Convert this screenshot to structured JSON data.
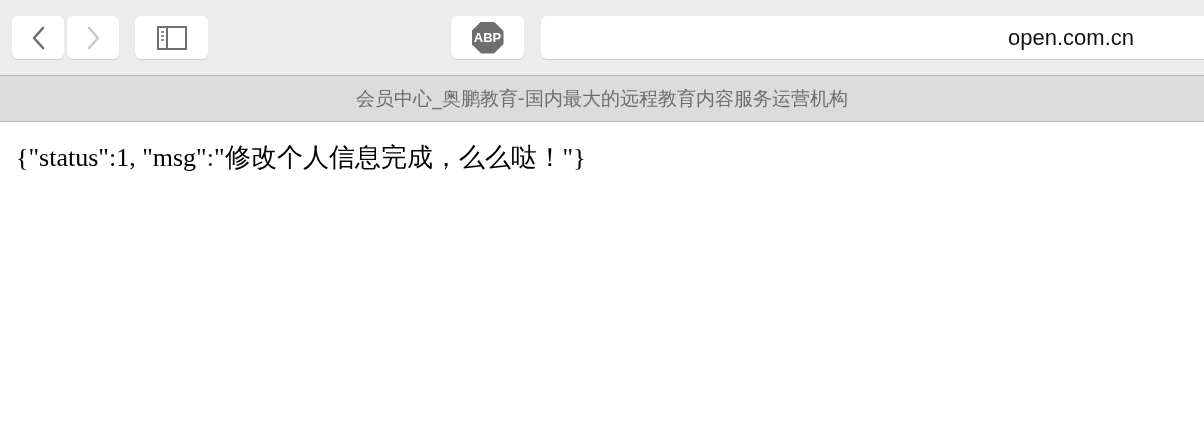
{
  "toolbar": {
    "buttons": [
      {
        "kind": "back",
        "disabled": false
      },
      {
        "kind": "forward",
        "disabled": true
      },
      {
        "kind": "sidebar",
        "disabled": false
      },
      {
        "kind": "adblock",
        "label": "ABP",
        "disabled": false
      }
    ],
    "address": {
      "value": "open.com.cn"
    }
  },
  "tab": {
    "title": "会员中心_奥鹏教育-国内最大的远程教育内容服务运营机构"
  },
  "page": {
    "text": "{\"status\":1, \"msg\":\"修改个人信息完成，么么哒！\"}"
  }
}
